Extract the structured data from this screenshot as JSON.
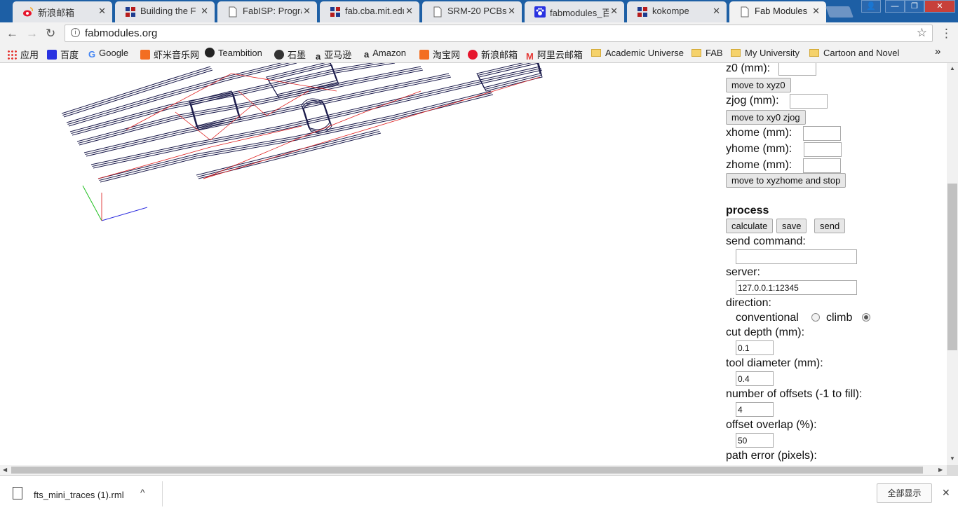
{
  "tabs": [
    {
      "label": "新浪邮箱",
      "favicon": "weibo-icon",
      "active": false
    },
    {
      "label": "Building the F",
      "favicon": "grid-icon",
      "active": false
    },
    {
      "label": "FabISP: Progra",
      "favicon": "page-icon",
      "active": false
    },
    {
      "label": "fab.cba.mit.edu",
      "favicon": "grid-icon",
      "active": false
    },
    {
      "label": "SRM-20 PCBs",
      "favicon": "page-icon",
      "active": false
    },
    {
      "label": "fabmodules_百",
      "favicon": "paw-icon",
      "active": false
    },
    {
      "label": "kokompe",
      "favicon": "grid-icon",
      "active": false
    },
    {
      "label": "Fab Modules",
      "favicon": "page-icon",
      "active": true
    }
  ],
  "window_controls": {
    "user": "👤",
    "minimize": "—",
    "maximize": "❐",
    "close": "✕"
  },
  "omnibar": {
    "url": "fabmodules.org",
    "back": "←",
    "forward": "→",
    "reload": "↻",
    "info": "i",
    "star": "☆",
    "menu": "⋮"
  },
  "bookmarks": [
    {
      "label": "应用",
      "icon": "apps-icon"
    },
    {
      "label": "百度",
      "icon": "paw-icon"
    },
    {
      "label": "Google",
      "icon": "google-icon"
    },
    {
      "label": "虾米音乐网",
      "icon": "xiami-icon"
    },
    {
      "label": "Teambition",
      "icon": "teambition-icon"
    },
    {
      "label": "石墨",
      "icon": "shimo-icon"
    },
    {
      "label": "亚马逊",
      "icon": "amazon-icon"
    },
    {
      "label": "Amazon",
      "icon": "amazon-icon"
    },
    {
      "label": "淘宝网",
      "icon": "taobao-icon"
    },
    {
      "label": "新浪邮箱",
      "icon": "weibo-icon"
    },
    {
      "label": "阿里云邮箱",
      "icon": "aliyun-mail-icon"
    },
    {
      "label": "Academic Universe",
      "icon": "folder-icon"
    },
    {
      "label": "FAB",
      "icon": "folder-icon"
    },
    {
      "label": "My University",
      "icon": "folder-icon"
    },
    {
      "label": "Cartoon and Novel",
      "icon": "folder-icon"
    }
  ],
  "bookmarks_overflow": "»",
  "panel": {
    "z0_label": "z0 (mm):",
    "z0_value": "",
    "move_xyz0": "move to xyz0",
    "zjog_label": "zjog (mm):",
    "zjog_value": "",
    "move_xy0_zjog": "move to xy0 zjog",
    "xhome_label": "xhome (mm):",
    "xhome_value": "",
    "yhome_label": "yhome (mm):",
    "yhome_value": "",
    "zhome_label": "zhome (mm):",
    "zhome_value": "",
    "move_home_stop": "move to xyzhome and stop",
    "process_heading": "process",
    "calculate": "calculate",
    "save": "save",
    "send": "send",
    "send_command_label": "send command:",
    "send_command_value": "",
    "server_label": "server:",
    "server_value": "127.0.0.1:12345",
    "direction_label": "direction:",
    "conventional_label": "conventional",
    "climb_label": "climb",
    "direction_selected": "climb",
    "cut_depth_label": "cut depth (mm):",
    "cut_depth_value": "0.1",
    "tool_diameter_label": "tool diameter (mm):",
    "tool_diameter_value": "0.4",
    "offsets_label": "number of offsets (-1 to fill):",
    "offsets_value": "4",
    "overlap_label": "offset overlap (%):",
    "overlap_value": "50",
    "path_error_label": "path error (pixels):"
  },
  "toolpath_colors": {
    "path": "#1a1a4a",
    "link": "#e02020",
    "axis_x": "#3030e0",
    "axis_y": "#20c020",
    "axis_z": "#e04040"
  },
  "scroll_arrows": {
    "up": "▲",
    "down": "▼",
    "left": "◀",
    "right": "▶"
  },
  "download": {
    "filename": "fts_mini_traces (1).rml",
    "chevron": "^",
    "show_all": "全部显示",
    "close": "✕"
  }
}
